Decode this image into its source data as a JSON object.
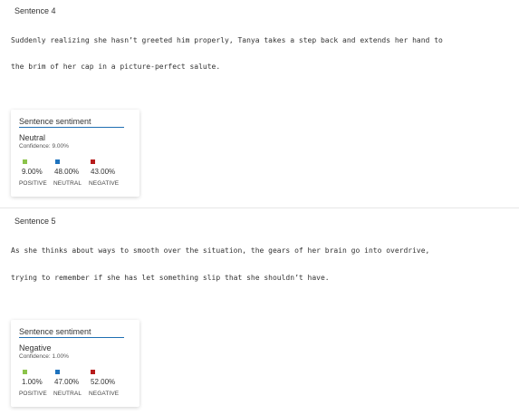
{
  "colors": {
    "positive": "#8bc34a",
    "neutral": "#1e73be",
    "negative": "#b71c1c",
    "header_underline": "#1f6fb2"
  },
  "sentences": [
    {
      "title": "Sentence 4",
      "lines": [
        "Suddenly realizing she hasn’t greeted him properly, Tanya takes a step back and extends her hand to",
        "the brim of her cap in a picture-perfect salute."
      ],
      "card": {
        "header": "Sentence sentiment",
        "label": "Neutral",
        "confidence": "Confidence: 9.00%",
        "scores": [
          {
            "category": "POSITIVE",
            "value": "9.00%"
          },
          {
            "category": "NEUTRAL",
            "value": "48.00%"
          },
          {
            "category": "NEGATIVE",
            "value": "43.00%"
          }
        ]
      }
    },
    {
      "title": "Sentence 5",
      "lines": [
        "As she thinks about ways to smooth over the situation, the gears of her brain go into overdrive,",
        "trying to remember if she has let something slip that she shouldn’t have."
      ],
      "card": {
        "header": "Sentence sentiment",
        "label": "Negative",
        "confidence": "Confidence: 1.00%",
        "scores": [
          {
            "category": "POSITIVE",
            "value": "1.00%"
          },
          {
            "category": "NEUTRAL",
            "value": "47.00%"
          },
          {
            "category": "NEGATIVE",
            "value": "52.00%"
          }
        ]
      }
    }
  ]
}
